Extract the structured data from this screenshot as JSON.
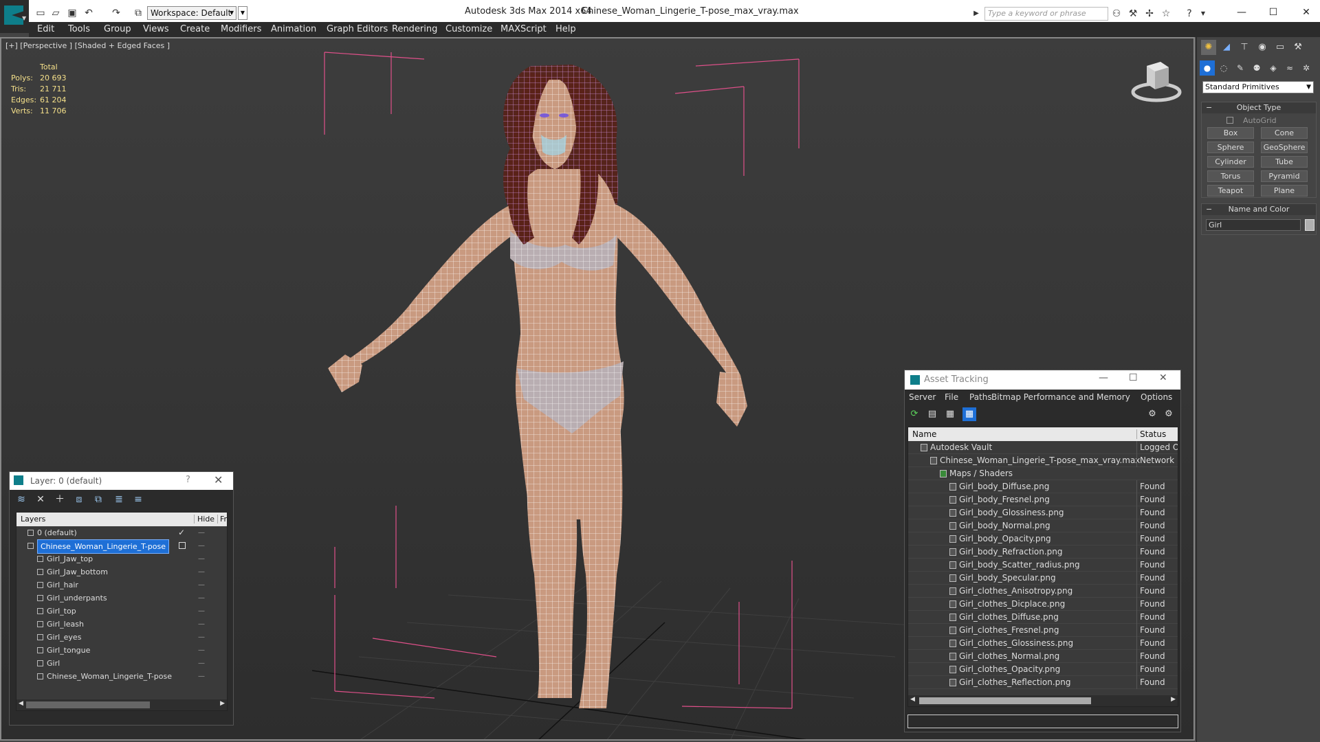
{
  "titlebar": {
    "app_title": "Autodesk 3ds Max  2014 x64",
    "document": "Chinese_Woman_Lingerie_T-pose_max_vray.max",
    "workspace": "Workspace: Default",
    "search_placeholder": "Type a keyword or phrase"
  },
  "menu": [
    "Edit",
    "Tools",
    "Group",
    "Views",
    "Create",
    "Modifiers",
    "Animation",
    "Graph Editors",
    "Rendering",
    "Customize",
    "MAXScript",
    "Help"
  ],
  "viewport": {
    "label": "[+] [Perspective ] [Shaded + Edged Faces ]",
    "stats": {
      "header": "Total",
      "rows": [
        {
          "key": "Polys:",
          "value": "20 693"
        },
        {
          "key": "Tris:",
          "value": "21 711"
        },
        {
          "key": "Edges:",
          "value": "61 204"
        },
        {
          "key": "Verts:",
          "value": "11 706"
        }
      ]
    }
  },
  "layer_window": {
    "title": "Layer: 0 (default)",
    "help": "?",
    "col_layers": "Layers",
    "col_hide": "Hide",
    "col_freeze": "Fr",
    "rows": [
      {
        "name": "0 (default)",
        "level": 1,
        "check": "✓",
        "selected": false
      },
      {
        "name": "Chinese_Woman_Lingerie_T-pose",
        "level": 1,
        "check": "",
        "selected": true
      },
      {
        "name": "Girl_Jaw_top",
        "level": 2,
        "check": "",
        "selected": false
      },
      {
        "name": "Girl_Jaw_bottom",
        "level": 2,
        "check": "",
        "selected": false
      },
      {
        "name": "Girl_hair",
        "level": 2,
        "check": "",
        "selected": false
      },
      {
        "name": "Girl_underpants",
        "level": 2,
        "check": "",
        "selected": false
      },
      {
        "name": "Girl_top",
        "level": 2,
        "check": "",
        "selected": false
      },
      {
        "name": "Girl_leash",
        "level": 2,
        "check": "",
        "selected": false
      },
      {
        "name": "Girl_eyes",
        "level": 2,
        "check": "",
        "selected": false
      },
      {
        "name": "Girl_tongue",
        "level": 2,
        "check": "",
        "selected": false
      },
      {
        "name": "Girl",
        "level": 2,
        "check": "",
        "selected": false
      },
      {
        "name": "Chinese_Woman_Lingerie_T-pose",
        "level": 2,
        "check": "",
        "selected": false
      }
    ]
  },
  "asset_window": {
    "title": "Asset Tracking",
    "menu": [
      "Server",
      "File",
      "Paths",
      "Bitmap Performance and Memory",
      "Options"
    ],
    "col_name": "Name",
    "col_status": "Status",
    "rows": [
      {
        "name": "Autodesk Vault",
        "level": 0,
        "status": "Logged Out"
      },
      {
        "name": "Chinese_Woman_Lingerie_T-pose_max_vray.max",
        "level": 1,
        "status": "Network Path"
      },
      {
        "name": "Maps / Shaders",
        "level": 2,
        "status": ""
      },
      {
        "name": "Girl_body_Diffuse.png",
        "level": 3,
        "status": "Found"
      },
      {
        "name": "Girl_body_Fresnel.png",
        "level": 3,
        "status": "Found"
      },
      {
        "name": "Girl_body_Glossiness.png",
        "level": 3,
        "status": "Found"
      },
      {
        "name": "Girl_body_Normal.png",
        "level": 3,
        "status": "Found"
      },
      {
        "name": "Girl_body_Opacity.png",
        "level": 3,
        "status": "Found"
      },
      {
        "name": "Girl_body_Refraction.png",
        "level": 3,
        "status": "Found"
      },
      {
        "name": "Girl_body_Scatter_radius.png",
        "level": 3,
        "status": "Found"
      },
      {
        "name": "Girl_body_Specular.png",
        "level": 3,
        "status": "Found"
      },
      {
        "name": "Girl_clothes_Anisotropy.png",
        "level": 3,
        "status": "Found"
      },
      {
        "name": "Girl_clothes_Dicplace.png",
        "level": 3,
        "status": "Found"
      },
      {
        "name": "Girl_clothes_Diffuse.png",
        "level": 3,
        "status": "Found"
      },
      {
        "name": "Girl_clothes_Fresnel.png",
        "level": 3,
        "status": "Found"
      },
      {
        "name": "Girl_clothes_Glossiness.png",
        "level": 3,
        "status": "Found"
      },
      {
        "name": "Girl_clothes_Normal.png",
        "level": 3,
        "status": "Found"
      },
      {
        "name": "Girl_clothes_Opacity.png",
        "level": 3,
        "status": "Found"
      },
      {
        "name": "Girl_clothes_Reflection.png",
        "level": 3,
        "status": "Found"
      }
    ]
  },
  "command_panel": {
    "primitive_dropdown": "Standard Primitives",
    "object_type": {
      "header": "Object Type",
      "autogrid": "AutoGrid",
      "buttons": [
        "Box",
        "Cone",
        "Sphere",
        "GeoSphere",
        "Cylinder",
        "Tube",
        "Torus",
        "Pyramid",
        "Teapot",
        "Plane"
      ]
    },
    "name_color": {
      "header": "Name and Color",
      "object_name": "Girl"
    }
  },
  "colors": {
    "accent": "#0e7e8a",
    "selection": "#1e6fd6",
    "wire": "#ffffff",
    "skin": "#c99a80",
    "bbox": "#e0508a",
    "stats_text": "#f5e08a"
  }
}
